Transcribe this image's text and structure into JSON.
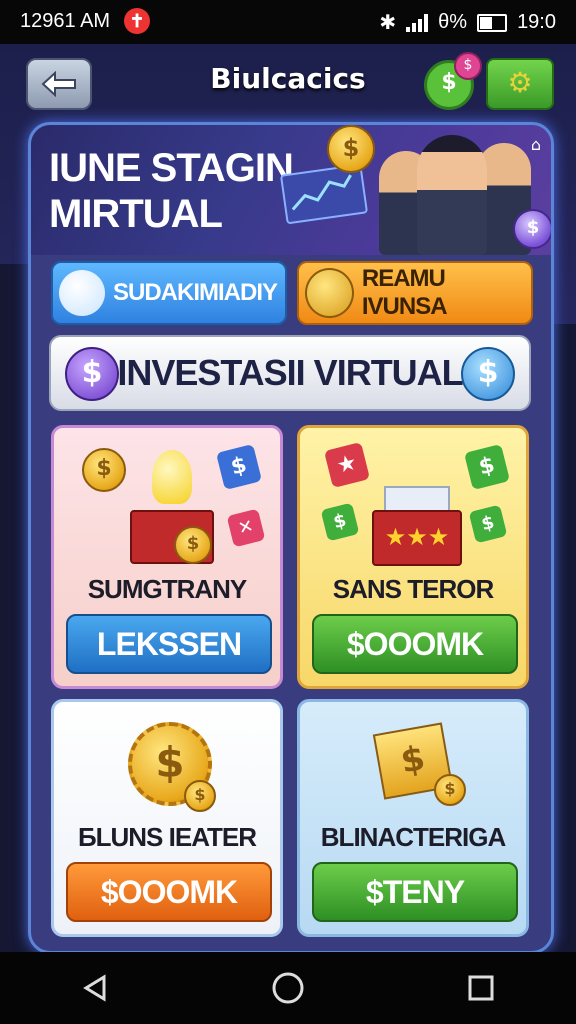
{
  "status_bar": {
    "time_left": "12961 AM",
    "battery": "θ%",
    "clock": "19:0"
  },
  "header": {
    "title": "Biulcacics"
  },
  "hero": {
    "title_line1": "IUNE STAGIN",
    "title_line2": "MIRTUAL"
  },
  "pills": {
    "left_label": "SUDAKIMIADIY",
    "right_label": "REAMU IVUNSA"
  },
  "banner": {
    "text": "INVESTASII VIRTUAL"
  },
  "cards": [
    {
      "label": "SUMGTRANY",
      "button": "LEKSSEN"
    },
    {
      "label": "SANS TEROR",
      "button": "$OOOMK"
    },
    {
      "label": "БLUNS IEATER",
      "button": "$OOOMK"
    },
    {
      "label": "BLINACTERIGA",
      "button": "$TENY"
    }
  ],
  "colors": {
    "accent_green": "#59c13a",
    "accent_orange": "#f08a14",
    "accent_blue": "#2f82e0"
  }
}
